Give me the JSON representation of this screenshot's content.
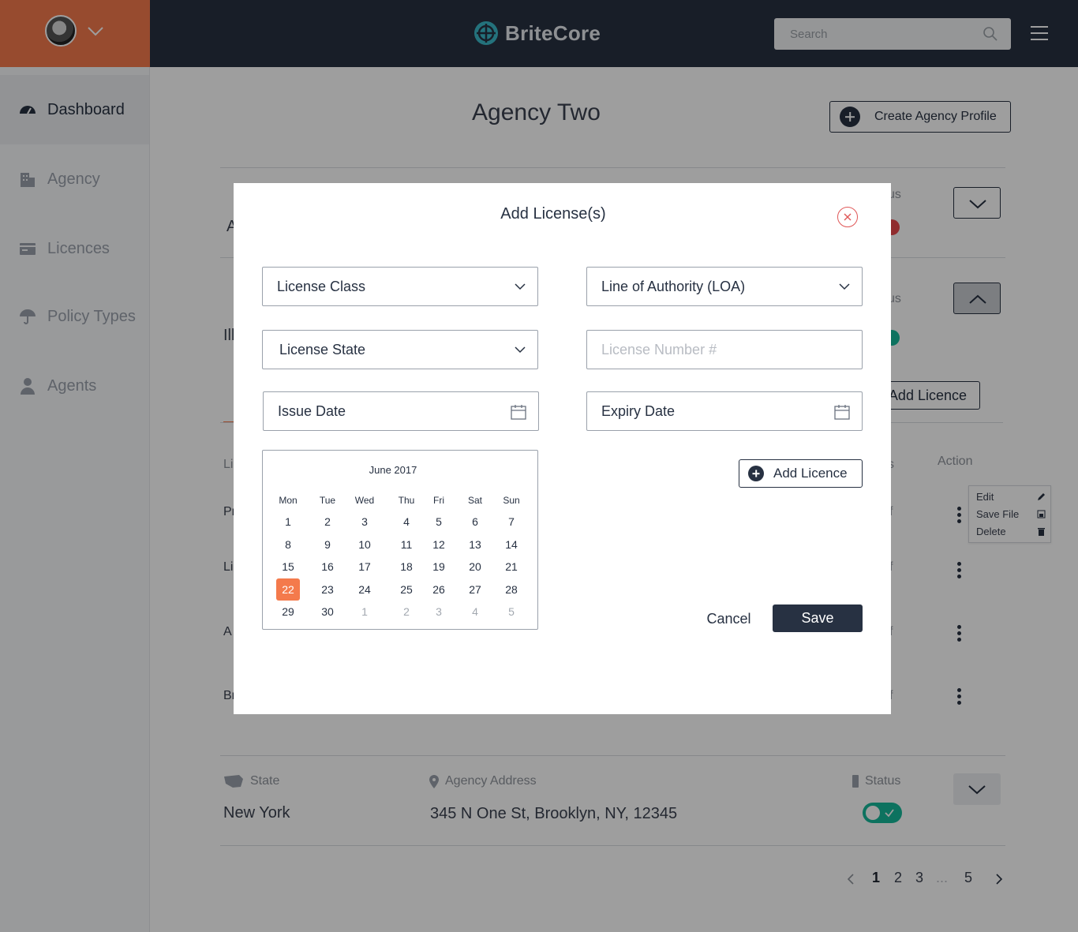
{
  "brand": {
    "name": "BriteCore"
  },
  "search": {
    "placeholder": "Search"
  },
  "sidebar": {
    "items": [
      {
        "label": "Dashboard",
        "icon": "gauge-icon",
        "active": true
      },
      {
        "label": "Agency",
        "icon": "building-icon",
        "active": false
      },
      {
        "label": "Licences",
        "icon": "card-icon",
        "active": false
      },
      {
        "label": "Policy Types",
        "icon": "umbrella-icon",
        "active": false
      },
      {
        "label": "Agents",
        "icon": "person-icon",
        "active": false
      }
    ]
  },
  "page": {
    "title": "Agency Two",
    "create_button": "Create Agency Profile"
  },
  "background": {
    "row1_partial_text": "A",
    "row1_status_partial": "us",
    "row2_partial_text": "Ill",
    "row2_status_partial": "us",
    "add_licence_label": "Add Licence",
    "table_header_left_partial": "Li",
    "table_header_status_partial": "s",
    "table_header_action": "Action",
    "rows_left_partial": [
      "Pr",
      "Li",
      "A",
      "Br"
    ],
    "rows_right_partial": [
      "f",
      "f",
      "f",
      "f"
    ],
    "action_menu": {
      "edit": "Edit",
      "save_file": "Save File",
      "delete": "Delete"
    },
    "state_label": "State",
    "address_label": "Agency Address",
    "status_label": "Status",
    "state_value": "New York",
    "address_value": "345 N One St, Brooklyn, NY, 12345",
    "status_colors": {
      "inactive": "#e8484b",
      "active": "#16b89a"
    }
  },
  "pagination": {
    "pages": [
      "1",
      "2",
      "3",
      "5"
    ],
    "ellipsis": "...",
    "current": "1"
  },
  "modal": {
    "title": "Add License(s)",
    "license_class": "License Class",
    "line_of_authority": "Line of Authority (LOA)",
    "license_state": "License State",
    "license_number_placeholder": "License Number #",
    "issue_date": "Issue Date",
    "expiry_date": "Expiry Date",
    "add_licence": "Add Licence",
    "cancel": "Cancel",
    "save": "Save"
  },
  "calendar": {
    "month_label": "June 2017",
    "weekdays": [
      "Mon",
      "Tue",
      "Wed",
      "Thu",
      "Fri",
      "Sat",
      "Sun"
    ],
    "weeks": [
      [
        "1",
        "2",
        "3",
        "4",
        "5",
        "6",
        "7"
      ],
      [
        "8",
        "9",
        "10",
        "11",
        "12",
        "13",
        "14"
      ],
      [
        "15",
        "16",
        "17",
        "18",
        "19",
        "20",
        "21"
      ],
      [
        "22",
        "23",
        "24",
        "25",
        "26",
        "27",
        "28"
      ],
      [
        "29",
        "30",
        "1",
        "2",
        "3",
        "4",
        "5"
      ]
    ],
    "selected_day": "22",
    "accent_color": "#f47a4c"
  }
}
